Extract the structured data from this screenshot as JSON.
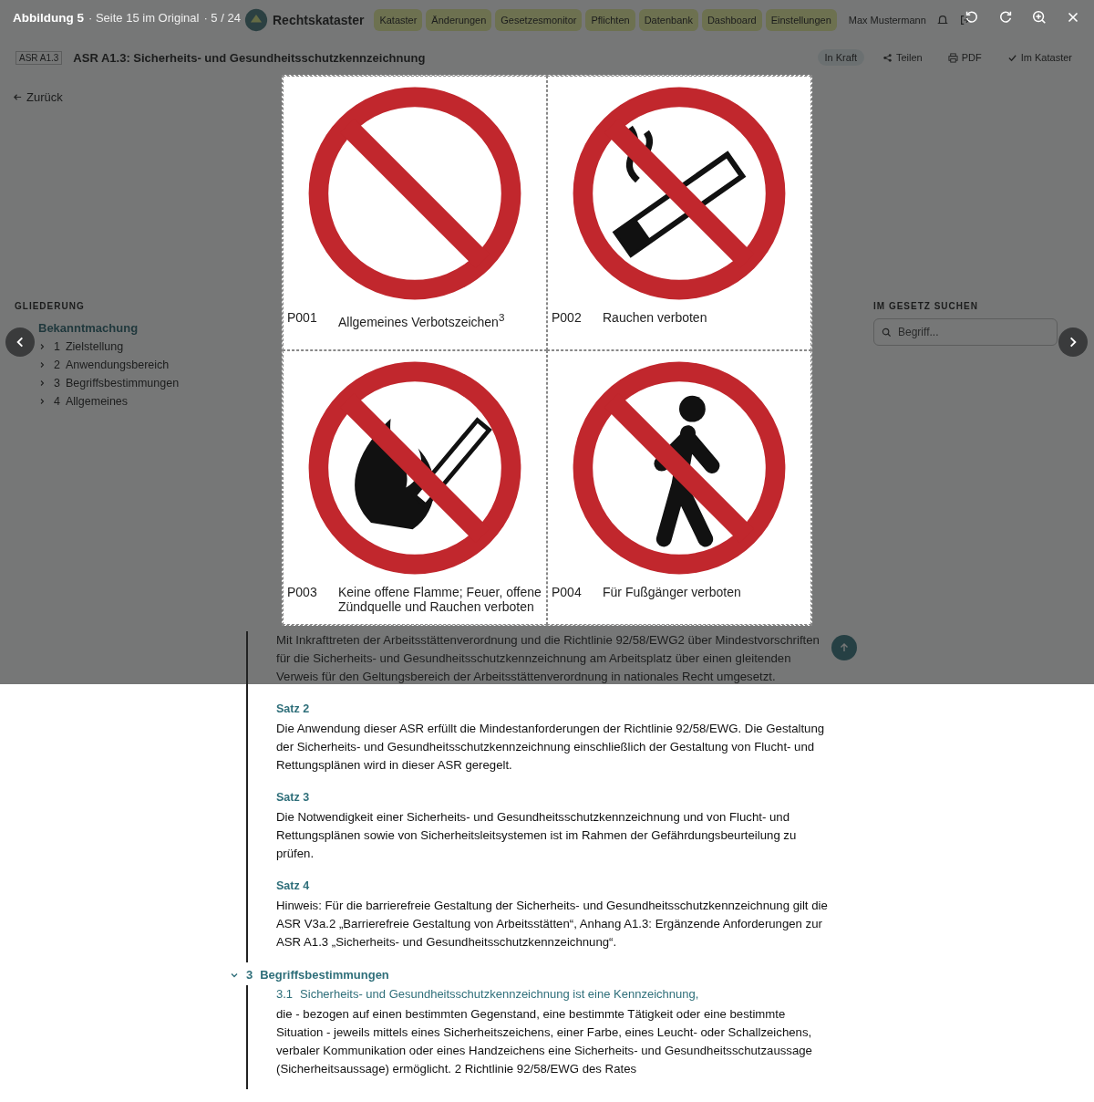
{
  "lightbox": {
    "title": "Abbildung 5",
    "page_note": "· Seite 15 im Original",
    "counter": "· 5 / 24",
    "signs": [
      {
        "kind": "general",
        "code": "P001",
        "caption": "Allgemeines Verbotszeichen$^{3}$"
      },
      {
        "kind": "smoking",
        "code": "P002",
        "caption": "Rauchen verboten"
      },
      {
        "kind": "flame",
        "code": "P003",
        "caption": "Keine offene Flamme; Feuer, offene Zündquelle und Rauchen verboten"
      },
      {
        "kind": "pedestrian",
        "code": "P004",
        "caption": "Für Fußgänger verboten"
      }
    ]
  },
  "header": {
    "brand": "Rechtskataster",
    "nav": [
      "Kataster",
      "Änderungen",
      "Gesetzesmonitor",
      "Pflichten",
      "Datenbank",
      "Dashboard",
      "Einstellungen"
    ],
    "user": "Max Mustermann"
  },
  "document": {
    "code": "ASR A1.3",
    "title": "ASR A1.3: Sicherheits- und Gesundheitsschutzkennzeichnung",
    "status": "In Kraft",
    "actions": [
      {
        "kind": "share",
        "label": "Teilen"
      },
      {
        "kind": "print",
        "label": "PDF"
      },
      {
        "kind": "check",
        "label": "Im Kataster"
      }
    ],
    "back": "Zurück"
  },
  "sidebar": {
    "heading": "GLIEDERUNG",
    "items": [
      {
        "title": "Bekanntmachung",
        "selected": true
      },
      {
        "number": "1",
        "title": "Zielstellung",
        "selected": false
      },
      {
        "number": "2",
        "title": "Anwendungsbereich",
        "selected": false
      },
      {
        "number": "3",
        "title": "Begriffsbestimmungen",
        "selected": false
      },
      {
        "number": "4",
        "title": "Allgemeines",
        "selected": false
      }
    ]
  },
  "search": {
    "heading": "IM GESETZ SUCHEN",
    "placeholder": "Begriff..."
  },
  "content": {
    "paragraph": "Mit Inkrafttreten der Arbeitsstättenverordnung und die Richtlinie 92/58/EWG2 über Mindestvorschriften für die Sicherheits- und Gesundheitsschutzkennzeichnung am Arbeitsplatz über einen gleitenden Verweis für den Geltungsbereich der Arbeitsstättenverordnung in nationales Recht umgesetzt.",
    "clauses": [
      {
        "label": "Satz 2",
        "text": "Die Anwendung dieser ASR erfüllt die Mindestanforderungen der Richtlinie 92/58/EWG. Die Gestaltung der Sicherheits- und Gesundheitsschutzkennzeichnung einschließlich der Gestaltung von Flucht- und Rettungsplänen wird in dieser ASR geregelt."
      },
      {
        "label": "Satz 3",
        "text": "Die Notwendigkeit einer Sicherheits- und Gesundheitsschutzkennzeichnung und von Flucht- und Rettungsplänen sowie von Sicherheitsleitsystemen ist im Rahmen der Gefährdungsbeurteilung zu prüfen."
      },
      {
        "label": "Satz 4",
        "text": "Hinweis: Für die barrierefreie Gestaltung der Sicherheits- und Gesundheitsschutzkennzeichnung gilt die ASR V3a.2 „Barrierefreie Gestaltung von Arbeitsstätten“, Anhang A1.3: Ergänzende Anforderungen zur ASR A1.3 „Sicherheits- und Gesundheitsschutzkennzeichnung“."
      }
    ],
    "section": {
      "number": "3",
      "title": "Begriffsbestimmungen",
      "expanded": true,
      "definition": {
        "number": "3.1",
        "title": "Sicherheits- und Gesundheitsschutzkennzeichnung ist eine Kennzeichnung,",
        "text": "die - bezogen auf einen bestimmten Gegenstand, eine bestimmte Tätigkeit oder eine bestimmte Situation - jeweils mittels eines Sicherheitszeichens, einer Farbe, eines Leucht- oder Schallzeichens, verbaler Kommunikation oder eines Handzeichens eine Sicherheits- und Gesundheitsschutzaussage (Sicherheitsaussage) ermöglicht. 2 Richtlinie 92/58/EWG des Rates"
      }
    }
  }
}
